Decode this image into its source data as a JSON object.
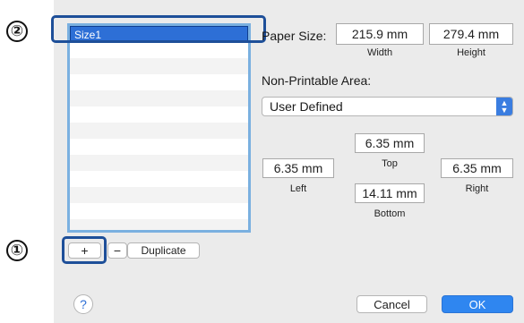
{
  "callouts": {
    "one": "①",
    "two": "②"
  },
  "paper_list": {
    "items": [
      "Size1"
    ],
    "selected_index": 0
  },
  "list_buttons": {
    "add": "+",
    "remove": "−",
    "duplicate": "Duplicate"
  },
  "paper_size": {
    "label": "Paper Size:",
    "width_value": "215.9 mm",
    "width_caption": "Width",
    "height_value": "279.4 mm",
    "height_caption": "Height"
  },
  "non_printable": {
    "label": "Non-Printable Area:",
    "select_value": "User Defined",
    "top_value": "6.35 mm",
    "top_caption": "Top",
    "left_value": "6.35 mm",
    "left_caption": "Left",
    "right_value": "6.35 mm",
    "right_caption": "Right",
    "bottom_value": "14.11 mm",
    "bottom_caption": "Bottom"
  },
  "footer": {
    "help": "?",
    "cancel": "Cancel",
    "ok": "OK"
  },
  "colors": {
    "selection": "#2d6fd6",
    "callout_border": "#1e4f99",
    "ok_button": "#2f86f0"
  }
}
